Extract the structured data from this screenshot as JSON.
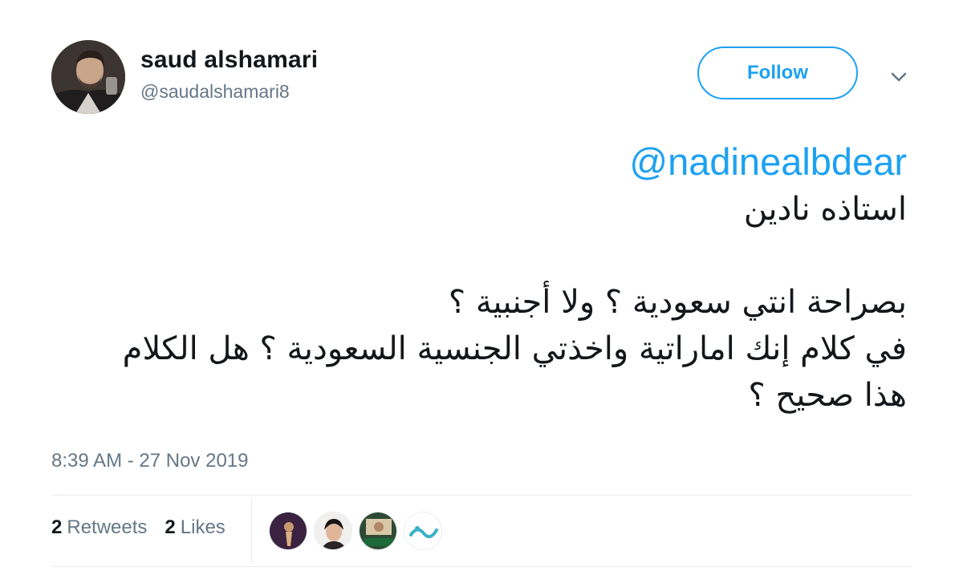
{
  "author": {
    "display_name": "saud alshamari",
    "handle": "@saudalshamari8"
  },
  "actions": {
    "follow_label": "Follow",
    "menu_icon": "chevron-down-icon"
  },
  "tweet": {
    "mention": "@nadinealbdear",
    "lines": [
      "استاذه نادين",
      "",
      "بصراحة انتي سعودية ؟ ولا أجنبية ؟",
      "في كلام إنك اماراتية واخذتي الجنسية السعودية  ؟ هل الكلام",
      "هذا صحيح ؟"
    ],
    "timestamp": "8:39 AM - 27 Nov 2019"
  },
  "stats": {
    "retweets_count": "2",
    "retweets_label": "Retweets",
    "likes_count": "2",
    "likes_label": "Likes"
  },
  "colors": {
    "accent": "#1da1f2",
    "secondary_text": "#657786",
    "primary_text": "#14171a",
    "divider": "#e6ecf0"
  }
}
